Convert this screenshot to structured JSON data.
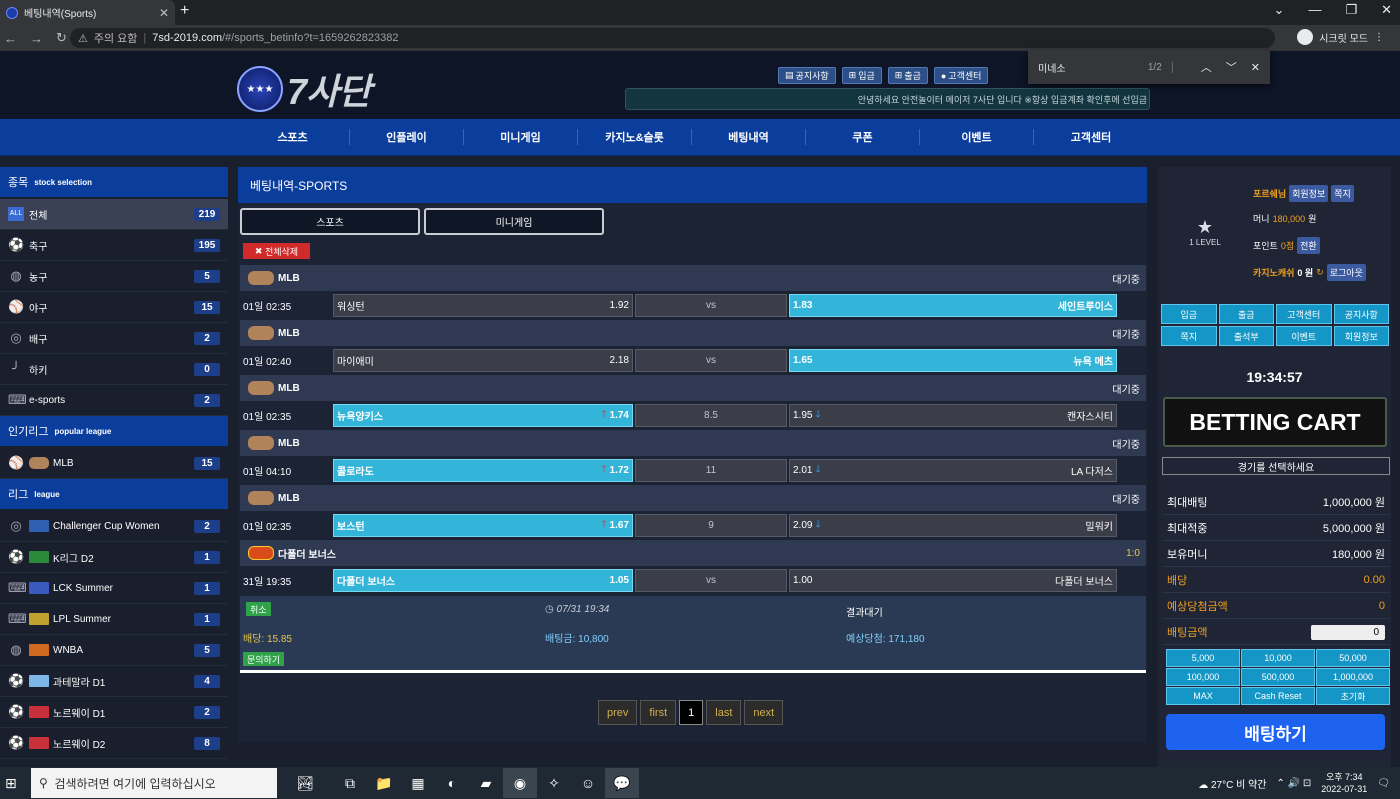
{
  "browser": {
    "tab_title": "베팅내역(Sports)",
    "addr_warn": "주의 요함",
    "domain": "7sd-2019.com",
    "path": "/#/sports_betinfo?t=1659262823382",
    "incognito": "시크릿 모드",
    "find": {
      "query": "미네소",
      "count": "1/2"
    }
  },
  "site": {
    "logo": "7사단",
    "top_buttons": [
      "공지사항",
      "입금",
      "출금",
      "고객센터"
    ],
    "marquee": "안녕하세요 안전놀이터 메이저 7사단 입니다 ※항상 입금계좌 확인후에 선입금",
    "nav": [
      "스포츠",
      "인플레이",
      "미니게임",
      "카지노&슬롯",
      "베팅내역",
      "쿠폰",
      "이벤트",
      "고객센터"
    ]
  },
  "left": {
    "sec1": "종목",
    "sec1_en": "stock selection",
    "sports": [
      {
        "label": "전체",
        "count": "219"
      },
      {
        "label": "축구",
        "count": "195"
      },
      {
        "label": "농구",
        "count": "5"
      },
      {
        "label": "야구",
        "count": "15"
      },
      {
        "label": "배구",
        "count": "2"
      },
      {
        "label": "하키",
        "count": "0"
      },
      {
        "label": "e-sports",
        "count": "2"
      }
    ],
    "sec2": "인기리그",
    "sec2_en": "popular league",
    "popular": [
      {
        "label": "MLB",
        "count": "15"
      }
    ],
    "sec3": "리그",
    "sec3_en": "league",
    "leagues": [
      {
        "label": "Challenger Cup Women",
        "count": "2"
      },
      {
        "label": "K리그 D2",
        "count": "1"
      },
      {
        "label": "LCK Summer",
        "count": "1"
      },
      {
        "label": "LPL Summer",
        "count": "1"
      },
      {
        "label": "WNBA",
        "count": "5"
      },
      {
        "label": "과테말라 D1",
        "count": "4"
      },
      {
        "label": "노르웨이 D1",
        "count": "2"
      },
      {
        "label": "노르웨이 D2",
        "count": "8"
      }
    ]
  },
  "center": {
    "title": "베팅내역-SPORTS",
    "tabs": [
      "스포츠",
      "미니게임"
    ],
    "delete_all": "전체삭제",
    "bets": [
      {
        "league": "MLB",
        "status": "대기중",
        "time": "01일 02:35",
        "home": "워싱턴",
        "home_odds": "1.92",
        "mid": "vs",
        "away": "세인트루이스",
        "away_odds": "1.83"
      },
      {
        "league": "MLB",
        "status": "대기중",
        "time": "01일 02:40",
        "home": "마이애미",
        "home_odds": "2.18",
        "mid": "vs",
        "away": "뉴욕 메츠",
        "away_odds": "1.65"
      },
      {
        "league": "MLB",
        "status": "대기중",
        "time": "01일 02:35",
        "home": "뉴욕양키스",
        "home_odds": "1.74",
        "mid": "8.5",
        "away": "캔자스시티",
        "away_odds": "1.95"
      },
      {
        "league": "MLB",
        "status": "대기중",
        "time": "01일 04:10",
        "home": "콜로라도",
        "home_odds": "1.72",
        "mid": "11",
        "away": "LA 다저스",
        "away_odds": "2.01"
      },
      {
        "league": "MLB",
        "status": "대기중",
        "time": "01일 02:35",
        "home": "보스턴",
        "home_odds": "1.67",
        "mid": "9",
        "away": "밀워키",
        "away_odds": "2.09"
      },
      {
        "league": "다폴더 보너스",
        "status": "1:0",
        "time": "31일 19:35",
        "home": "다폴더 보너스",
        "home_odds": "1.05",
        "mid": "vs",
        "away": "다폴더 보너스",
        "away_odds": "1.00"
      }
    ],
    "summary": {
      "cancel": "취소",
      "date": "07/31 19:34",
      "result": "결과대기",
      "odds": "배당: 15.85",
      "amount": "배팅금: 10,800",
      "expected": "예상당첨: 171,180",
      "inquiry": "문의하기"
    },
    "pager": [
      "prev",
      "first",
      "1",
      "last",
      "next"
    ]
  },
  "right": {
    "level": "1 LEVEL",
    "user": "포르쉐님",
    "member_info": "회원정보",
    "memo": "쪽지",
    "money_label": "머니",
    "money": "180,000",
    "won": "원",
    "point_label": "포인트",
    "point": "0점",
    "convert": "전환",
    "casino_label": "카지노캐쉬",
    "casino": "0 원",
    "logout": "로그아웃",
    "grid": [
      "입금",
      "출금",
      "고객센터",
      "공지사항",
      "쪽지",
      "출석부",
      "이벤트",
      "회원정보"
    ],
    "clock": "19:34:57",
    "cart": "BETTING CART",
    "select": "경기를 선택하세요",
    "rows": [
      {
        "k": "최대배팅",
        "v": "1,000,000 원"
      },
      {
        "k": "최대적중",
        "v": "5,000,000 원"
      },
      {
        "k": "보유머니",
        "v": "180,000 원"
      },
      {
        "k": "배당",
        "v": "0.00"
      },
      {
        "k": "예상당첨금액",
        "v": "0"
      },
      {
        "k": "배팅금액",
        "v": ""
      }
    ],
    "bet_amount": "0",
    "amounts": [
      "5,000",
      "10,000",
      "50,000",
      "100,000",
      "500,000",
      "1,000,000",
      "MAX",
      "Cash Reset",
      "초기화"
    ],
    "bet_button": "배팅하기"
  },
  "taskbar": {
    "search": "검색하려면 여기에 입력하십시오",
    "weather": "27°C 비 약간",
    "ampm": "오후 7:34",
    "date": "2022-07-31"
  }
}
